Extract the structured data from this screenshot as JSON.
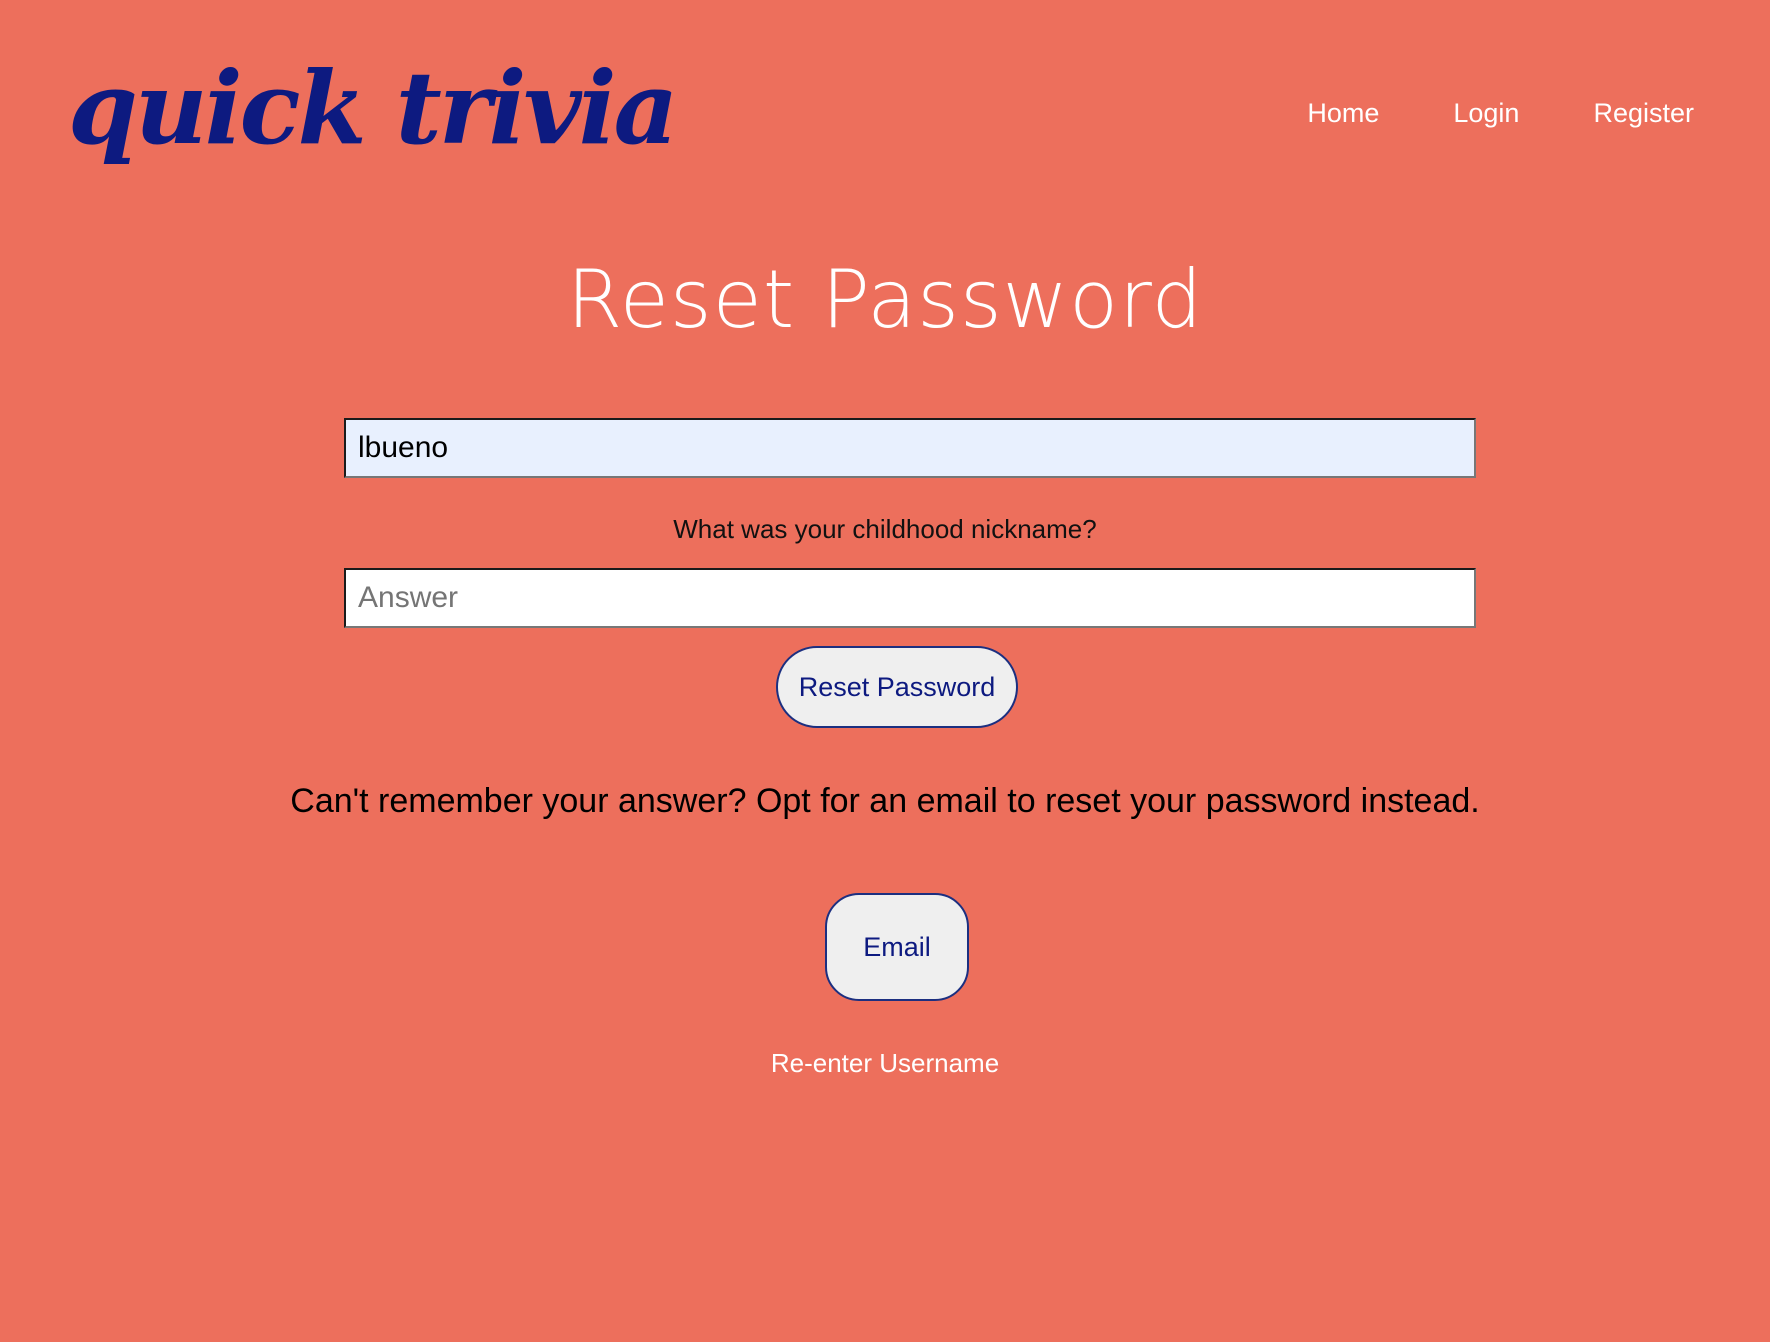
{
  "brand": {
    "logo_text": "quick trivia",
    "colors": {
      "background": "#ed6f5c",
      "logo": "#0d1a80",
      "button_text": "#0d1a80",
      "button_bg": "#efefef",
      "autofill_bg": "#e8f0fe"
    }
  },
  "nav": {
    "items": [
      {
        "label": "Home"
      },
      {
        "label": "Login"
      },
      {
        "label": "Register"
      }
    ]
  },
  "main": {
    "title": "Reset Password",
    "username": {
      "value": "lbueno"
    },
    "security_question": "What was your childhood nickname?",
    "answer": {
      "value": "",
      "placeholder": "Answer"
    },
    "reset_button_label": "Reset Password",
    "alternative_text": "Can't remember your answer? Opt for an email to reset your password instead.",
    "email_button_label": "Email",
    "reenter_link_label": "Re-enter Username"
  }
}
